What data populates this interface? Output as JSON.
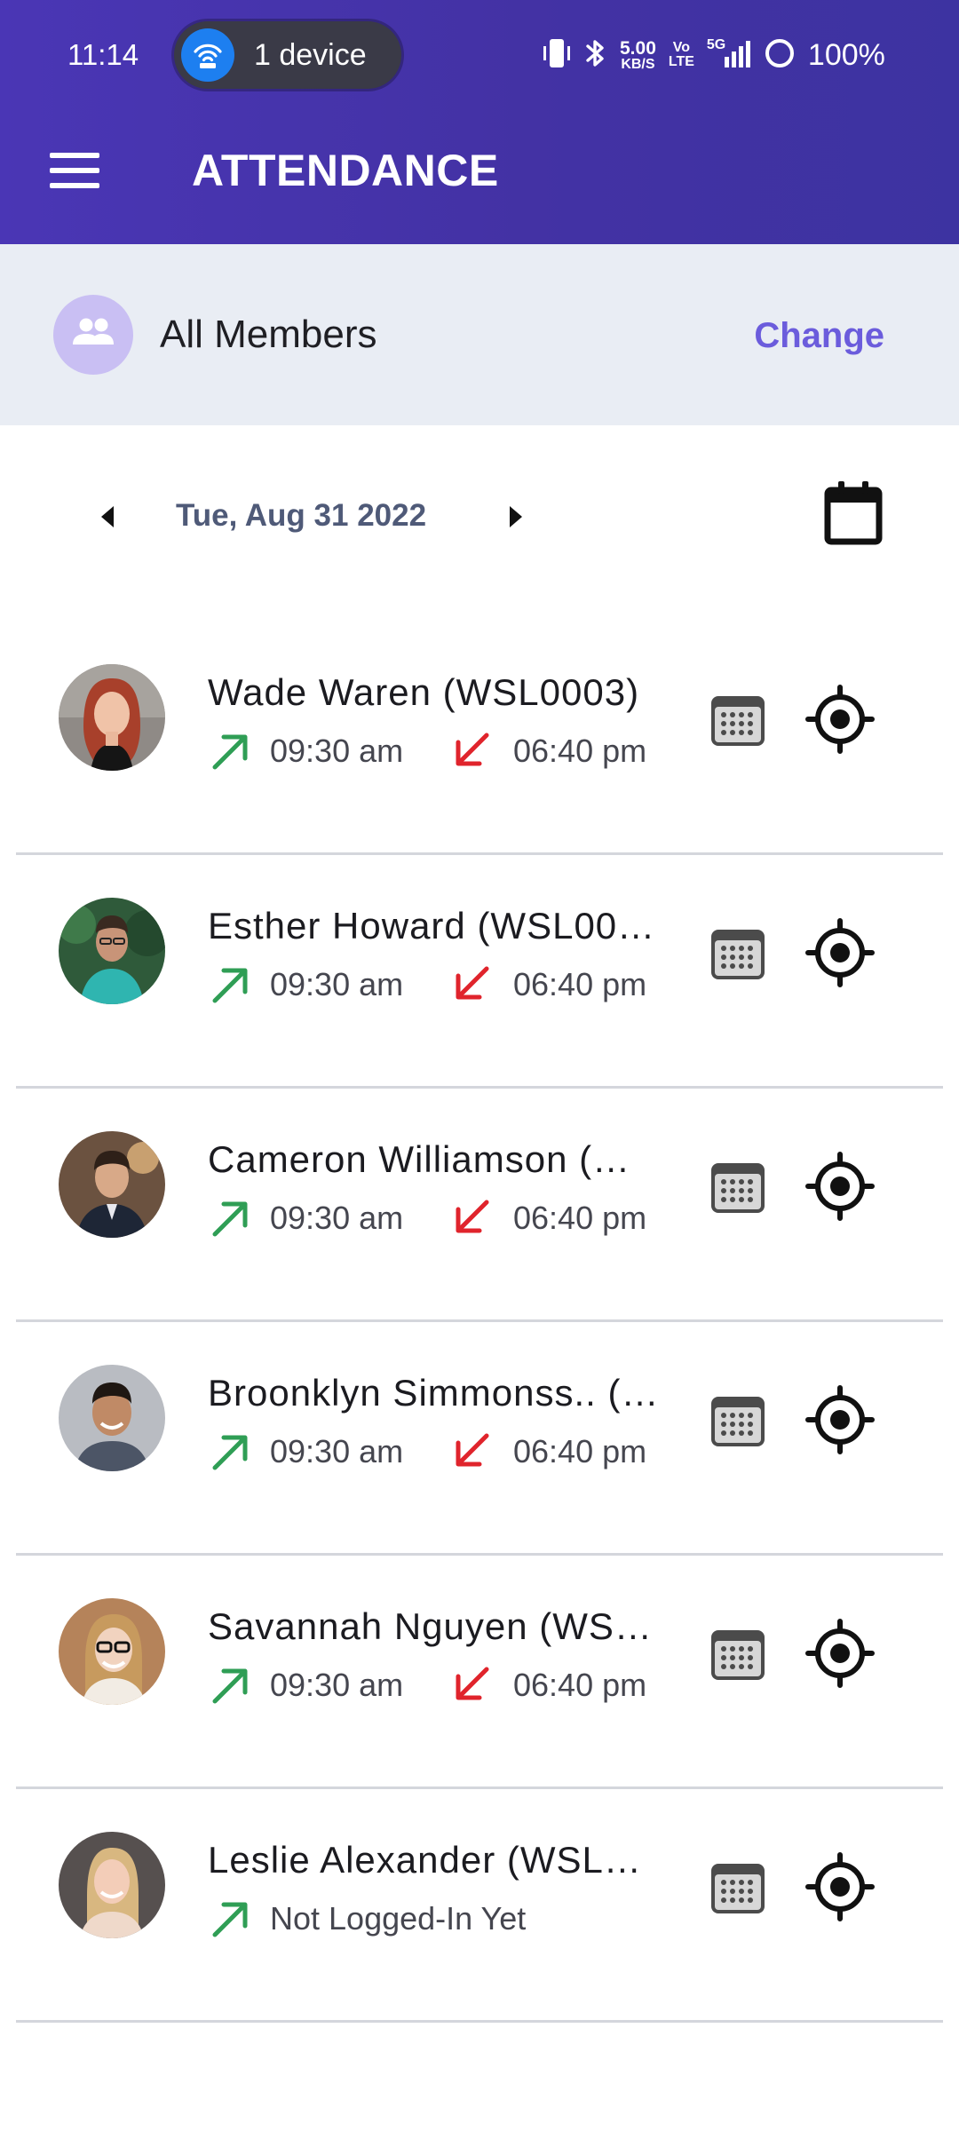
{
  "status_bar": {
    "time": "11:14",
    "device_pill": "1 device",
    "net_speed_value": "5.00",
    "net_speed_unit": "KB/S",
    "volte_top": "Vo",
    "volte_bottom": "LTE",
    "network": "5G",
    "battery": "100%"
  },
  "app_bar": {
    "title": "ATTENDANCE",
    "menu_icon": "hamburger-menu-icon"
  },
  "filter": {
    "label": "All Members",
    "action": "Change",
    "icon": "group-icon"
  },
  "date_nav": {
    "date": "Tue, Aug 31 2022",
    "prev_icon": "caret-left-icon",
    "next_icon": "caret-right-icon",
    "calendar_icon": "calendar-icon"
  },
  "colors": {
    "header": "#4332a4",
    "accent": "#6b5cdc",
    "check_in": "#2f9e55",
    "check_out": "#e0242c",
    "filter_bg": "#e9edf4"
  },
  "members": [
    {
      "name": "Wade Waren (WSL0003)",
      "in": "09:30 am",
      "out": "06:40 pm"
    },
    {
      "name": "Esther Howard (WSL00…",
      "in": "09:30 am",
      "out": "06:40 pm"
    },
    {
      "name": "Cameron Williamson (…",
      "in": "09:30 am",
      "out": "06:40 pm"
    },
    {
      "name": "Broonklyn Simmonss.. (…",
      "in": "09:30 am",
      "out": "06:40 pm"
    },
    {
      "name": "Savannah Nguyen (WSL…",
      "in": "09:30 am",
      "out": "06:40 pm"
    },
    {
      "name": "Leslie Alexander (WSL0…",
      "in": "Not Logged-In Yet",
      "out": null
    }
  ]
}
